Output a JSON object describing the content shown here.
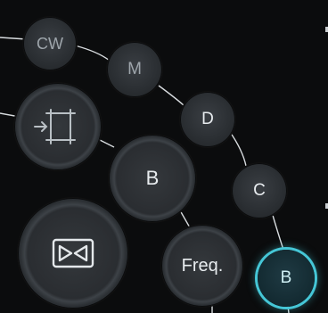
{
  "mode_buttons": {
    "cw": "CW",
    "m": "M",
    "d": "D",
    "c": "C",
    "b_small": "B",
    "b_large": "B",
    "freq": "Freq."
  },
  "icons": {
    "image_transfer": "film-arrow-icon",
    "freeze": "bowtie-freeze-icon"
  },
  "colors": {
    "active_accent": "#45c6d6",
    "background": "#0b0c0d"
  }
}
